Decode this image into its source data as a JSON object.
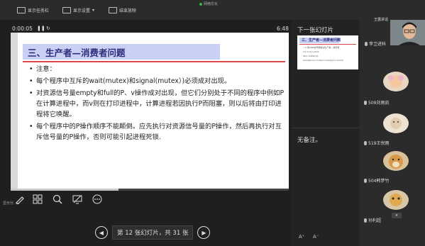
{
  "topbar": {
    "item1": "显示任务栏",
    "item2": "显示设置",
    "item3": "结束放映",
    "recording": "网络优化"
  },
  "presenter": {
    "elapsed": "0:00:05",
    "clock": "6:48",
    "progress": 0.387
  },
  "slide": {
    "title": "三、生产者—消费者问题",
    "bullets": [
      "注意：",
      "每个程序中互斥的wait(mutex)和signal(mutex）)必须成对出现。",
      "对资源信号量empty和full的P、v操作成对出现，但它们分别处于不同的程序中例如P在计算进程中，而v则在打印进程中，计算进程若因执行P而阻塞，则以后将由打印进程将它唤醒。",
      "每个程序中的P操作顺序不能颠倒。应先执行对资源信号量的P操作，然后再执行对互斥信号量的P操作，否则可能引起进程死锁."
    ]
  },
  "right_pane": {
    "next_label": "下一张幻灯片",
    "notes_label": "无备注。",
    "thumb_title": "三、生产者—消费者问题",
    "thumb_lines": [
      "• 2.用AND信号量解决生产者—消费者",
      "int in=0,out=0;",
      "item buffer[n];",
      "Semaphore mutex=1,empty=n,full=0"
    ],
    "font_up": "A⁺",
    "font_down": "A⁻"
  },
  "nav": {
    "prev": "◀",
    "label": "第 12 张幻灯片，共 31 张",
    "next": "▶"
  },
  "bottom_left": "显示分...",
  "participants": {
    "title": "王露讲话",
    "host_name": "李卫进科",
    "list": [
      {
        "name": "509刘雨凯"
      },
      {
        "name": "519王悦雨"
      },
      {
        "name": "504韩梦竹"
      },
      {
        "name": "孙利超"
      }
    ]
  }
}
